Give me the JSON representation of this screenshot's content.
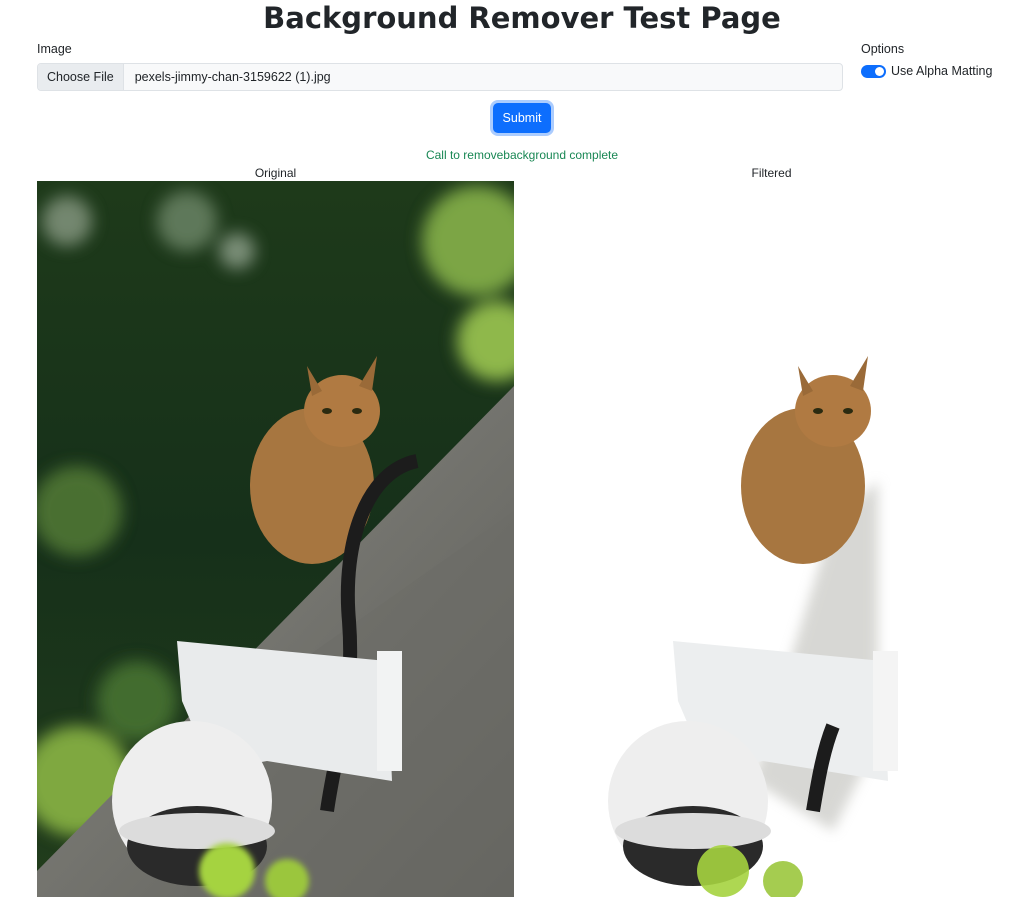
{
  "page": {
    "title": "Background Remover Test Page"
  },
  "form": {
    "image_label": "Image",
    "choose_file_label": "Choose File",
    "file_name": "pexels-jimmy-chan-3159622 (1).jpg",
    "options_label": "Options",
    "alpha_matting_label": "Use Alpha Matting",
    "alpha_matting_enabled": true,
    "submit_label": "Submit"
  },
  "status": {
    "message": "Call to removebackground complete"
  },
  "results": {
    "original_caption": "Original",
    "filtered_caption": "Filtered"
  },
  "colors": {
    "accent": "#0d6efd",
    "success_text": "#198754"
  }
}
